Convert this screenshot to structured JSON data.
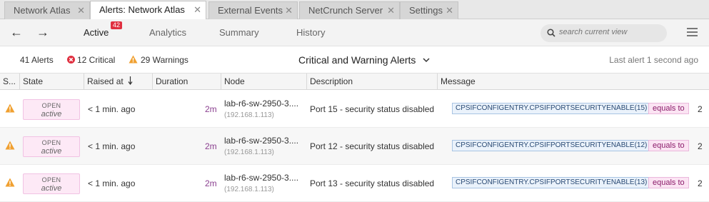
{
  "tabs": [
    {
      "label": "Network Atlas",
      "active": false
    },
    {
      "label": "Alerts: Network Atlas",
      "active": true
    },
    {
      "label": "External Events",
      "active": false
    },
    {
      "label": "NetCrunch Server",
      "active": false
    },
    {
      "label": "Settings",
      "active": false
    }
  ],
  "toolbar": {
    "views": [
      "Active",
      "Analytics",
      "Summary",
      "History"
    ],
    "active_badge": "42",
    "search_placeholder": "search current view"
  },
  "summary": {
    "alerts": "41 Alerts",
    "critical": "12 Critical",
    "warnings": "29 Warnings",
    "view_title": "Critical and Warning Alerts",
    "last_alert": "Last alert 1 second ago"
  },
  "columns": [
    "S...",
    "State",
    "Raised at",
    "Duration",
    "Node",
    "Description",
    "Message"
  ],
  "rows": [
    {
      "state_top": "OPEN",
      "state_bottom": "active",
      "raised": "< 1 min. ago",
      "duration": "2m",
      "node": "lab-r6-sw-2950-3....",
      "ip": "(192.168.1.113)",
      "description": "Port 15 - security status disabled",
      "message": "CPSIFCONFIGENTRY.CPSIFPORTSECURITYENABLE(15)",
      "op": "equals to",
      "value": "2"
    },
    {
      "state_top": "OPEN",
      "state_bottom": "active",
      "raised": "< 1 min. ago",
      "duration": "2m",
      "node": "lab-r6-sw-2950-3....",
      "ip": "(192.168.1.113)",
      "description": "Port 12 - security status disabled",
      "message": "CPSIFCONFIGENTRY.CPSIFPORTSECURITYENABLE(12)",
      "op": "equals to",
      "value": "2"
    },
    {
      "state_top": "OPEN",
      "state_bottom": "active",
      "raised": "< 1 min. ago",
      "duration": "2m",
      "node": "lab-r6-sw-2950-3....",
      "ip": "(192.168.1.113)",
      "description": "Port 13 - security status disabled",
      "message": "CPSIFCONFIGENTRY.CPSIFPORTSECURITYENABLE(13)",
      "op": "equals to",
      "value": "2"
    }
  ],
  "icons": {
    "back": "arrow-left-icon",
    "forward": "arrow-right-icon",
    "search": "search-icon",
    "menu": "hamburger-menu-icon",
    "critical": "critical-x-circle-icon",
    "warning": "warning-triangle-icon",
    "sort": "sort-down-arrow-icon",
    "dropdown": "chevron-down-icon"
  },
  "colors": {
    "critical": "#e03040",
    "warning": "#f0a030",
    "state_bg": "#fde9f6",
    "message_bg": "#eaf2fb",
    "op_bg": "#fbe4f3"
  }
}
